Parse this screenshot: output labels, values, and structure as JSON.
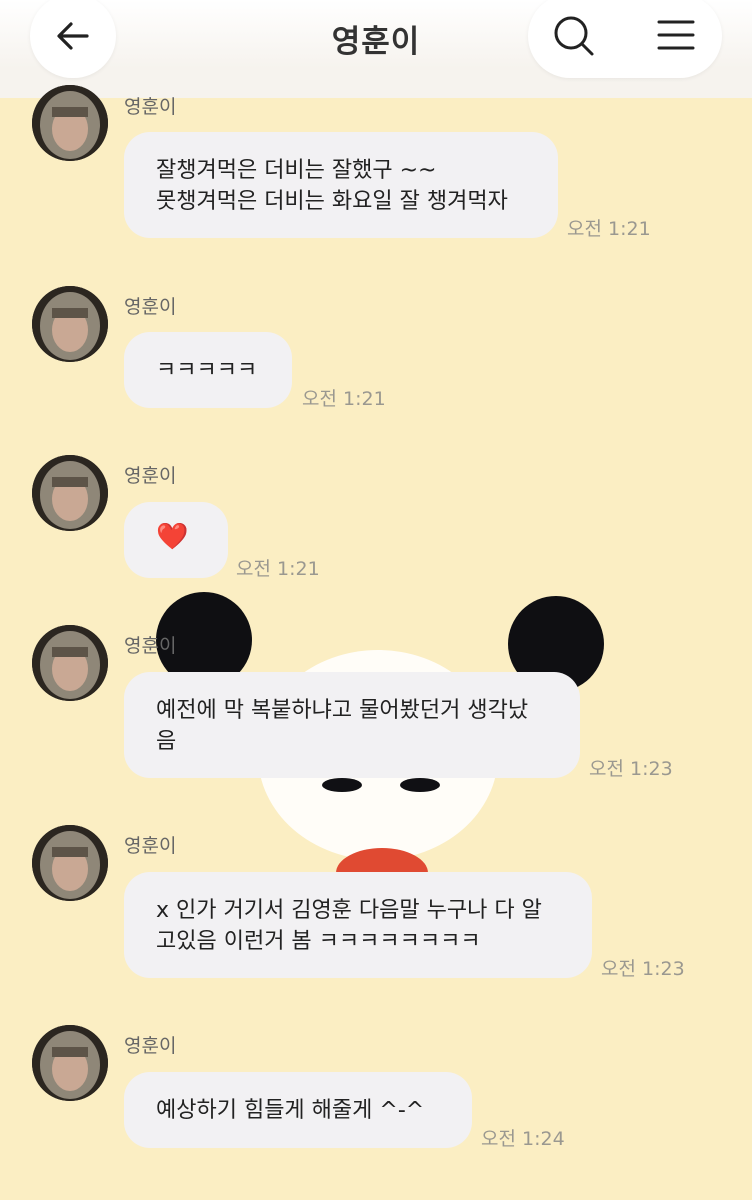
{
  "header": {
    "title": "영훈이",
    "back_icon": "arrow-left-icon",
    "search_icon": "search-icon",
    "menu_icon": "hamburger-menu-icon"
  },
  "messages": [
    {
      "sender": "영훈이",
      "text": "잘챙겨먹은 더비는 잘했구 ~~\n못챙겨먹은 더비는 화요일 잘 챙겨먹자",
      "time": "오전 1:21"
    },
    {
      "sender": "영훈이",
      "text": "ㅋㅋㅋㅋㅋ",
      "time": "오전 1:21"
    },
    {
      "sender": "영훈이",
      "text": "❤️",
      "time": "오전 1:21"
    },
    {
      "sender": "영훈이",
      "text": "예전에 막 복붙하냐고 물어봤던거 생각났\n음",
      "time": "오전 1:23"
    },
    {
      "sender": "영훈이",
      "text": "x 인가 거기서 김영훈 다음말 누구나 다 알\n고있음 이런거 봄 ㅋㅋㅋㅋㅋㅋㅋㅋ",
      "time": "오전 1:23"
    },
    {
      "sender": "영훈이",
      "text": "예상하기 힘들게 해줄게 ^-^",
      "time": "오전 1:24"
    }
  ]
}
